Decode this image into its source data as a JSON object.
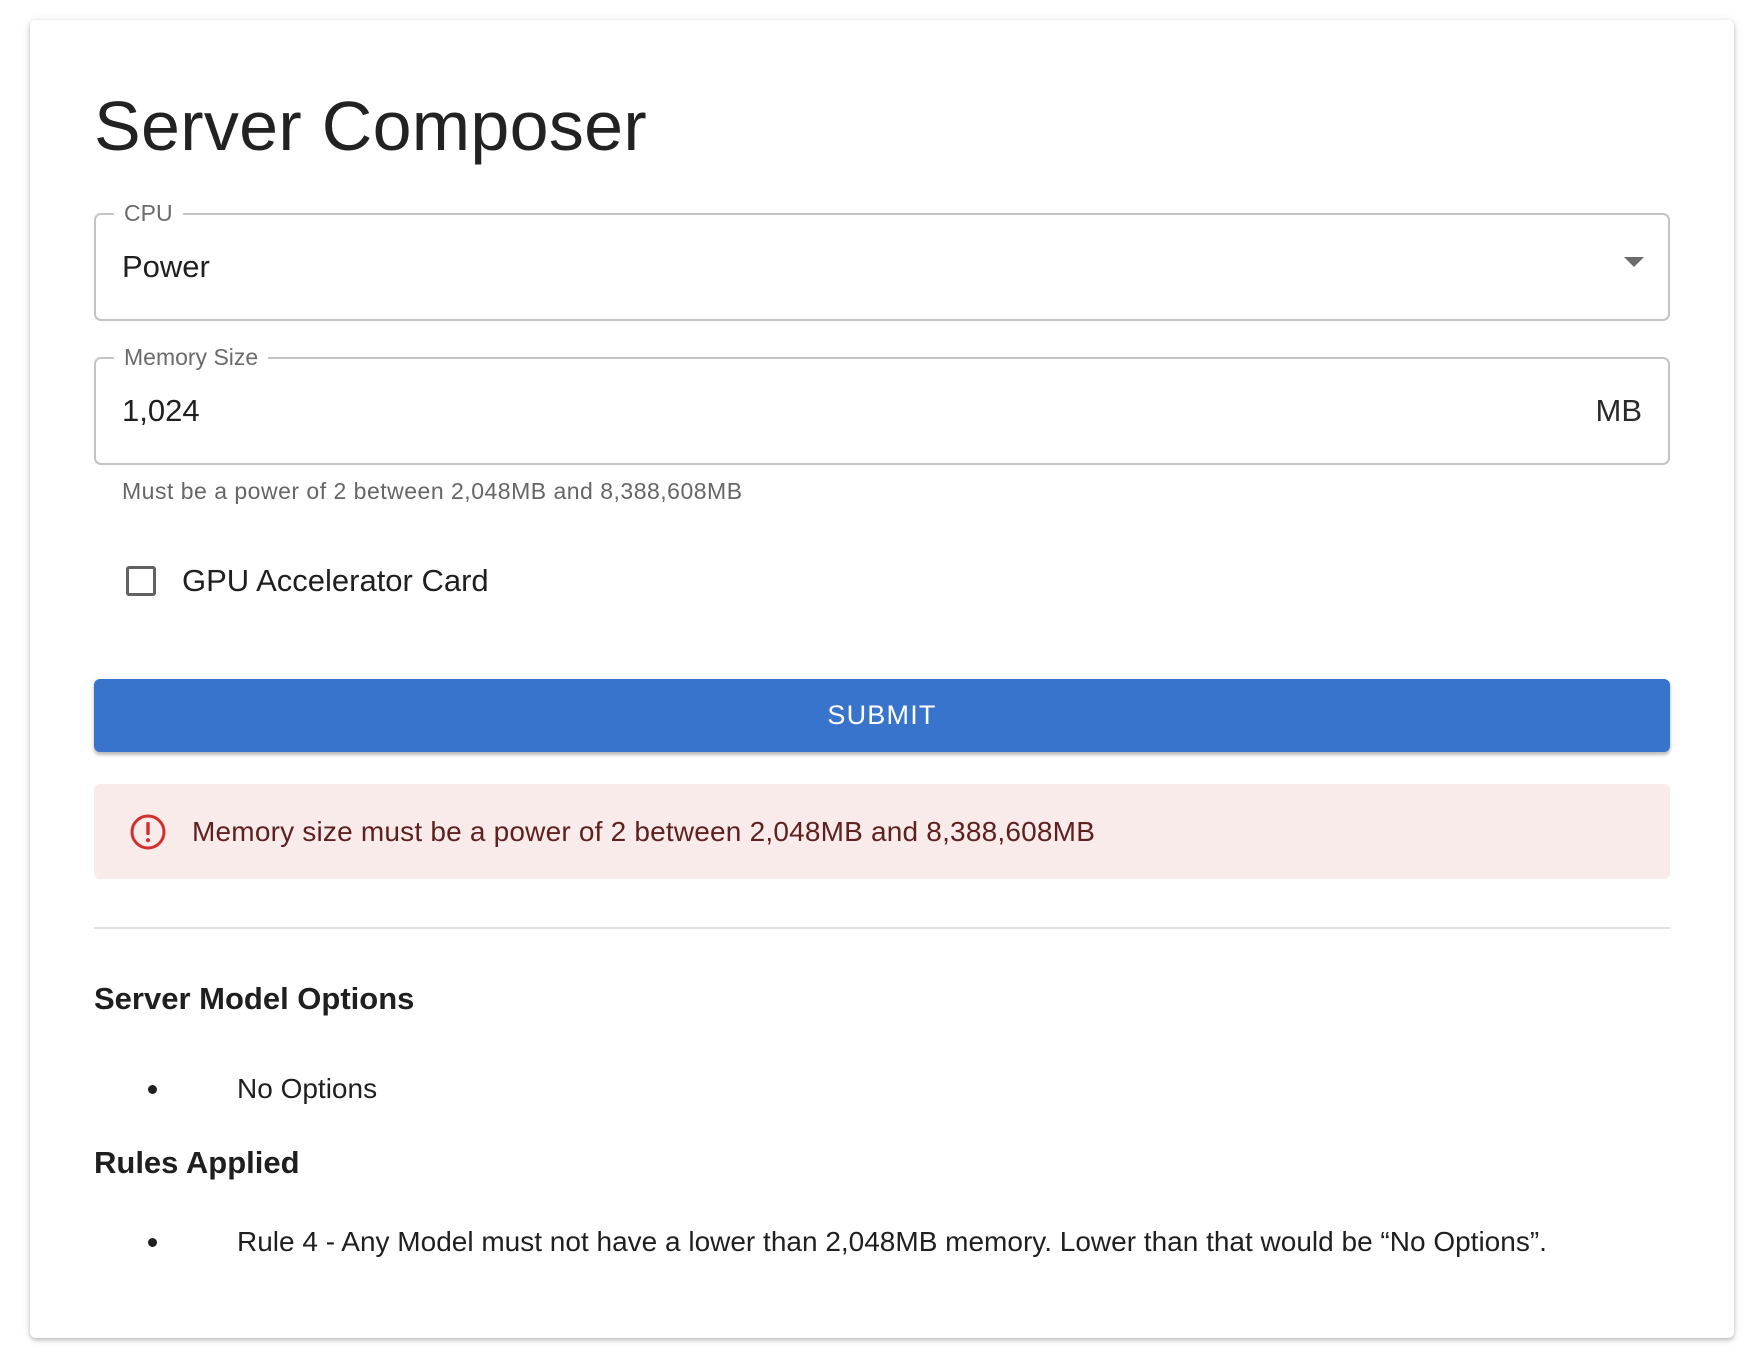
{
  "page": {
    "title": "Server Composer"
  },
  "form": {
    "cpu": {
      "label": "CPU",
      "value": "Power"
    },
    "memory": {
      "label": "Memory Size",
      "value": "1,024",
      "unit": "MB",
      "helper_text": "Must be a power of 2 between 2,048MB and 8,388,608MB"
    },
    "gpu": {
      "label": "GPU Accelerator Card",
      "checked": false
    },
    "submit_label": "SUBMIT"
  },
  "alert": {
    "severity": "error",
    "icon": "error-outline-icon",
    "message": "Memory size must be a power of 2 between 2,048MB and 8,388,608MB"
  },
  "results": {
    "options_heading": "Server Model Options",
    "options": [
      "No Options"
    ],
    "rules_heading": "Rules Applied",
    "rules": [
      "Rule 4 - Any Model must not have a lower than 2,048MB memory. Lower than that would be “No Options”."
    ]
  },
  "colors": {
    "primary": "#3874cb",
    "error_background": "#f9ebea",
    "error_text": "#5f2120",
    "error_icon": "#d32f2f"
  }
}
